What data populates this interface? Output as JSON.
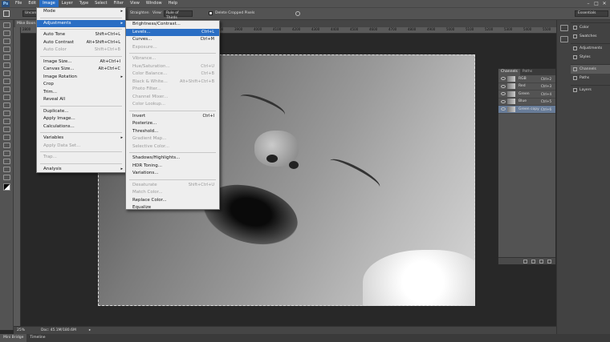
{
  "menubar": {
    "logo": "Ps",
    "items": [
      "File",
      "Edit",
      "Image",
      "Layer",
      "Type",
      "Select",
      "Filter",
      "View",
      "Window",
      "Help"
    ]
  },
  "options": {
    "brightness": "Straighten",
    "view_label": "View:",
    "view_value": "Rule of Thirds",
    "delete_label": "Delete Cropped Pixels",
    "unconstrained": "Unconst..."
  },
  "workspace": "Essentials",
  "document": {
    "tab": "Mike Boon..."
  },
  "rulers": [
    "2800",
    "2900",
    "3000",
    "3100",
    "3200",
    "3300",
    "3400",
    "3500",
    "3600",
    "3700",
    "3800",
    "3900",
    "4000",
    "4100",
    "4200",
    "4300",
    "4400",
    "4500",
    "4600",
    "4700",
    "4800",
    "4900",
    "5000",
    "5100",
    "5200",
    "5300",
    "5400",
    "5500"
  ],
  "status": {
    "zoom": "25%",
    "doc": "Doc: 45.1M/180.6M"
  },
  "bottom_tabs": [
    "Mini Bridge",
    "Timeline"
  ],
  "dock": {
    "groups": [
      [
        {
          "label": "Color",
          "icon": "color-icon"
        },
        {
          "label": "Swatches",
          "icon": "swatches-icon"
        }
      ],
      [
        {
          "label": "Adjustments",
          "icon": "adjustments-icon"
        },
        {
          "label": "Styles",
          "icon": "styles-icon"
        }
      ],
      [
        {
          "label": "Channels",
          "icon": "channels-icon",
          "active": true
        },
        {
          "label": "Paths",
          "icon": "paths-icon"
        }
      ],
      [
        {
          "label": "Layers",
          "icon": "layers-icon"
        }
      ]
    ]
  },
  "channels_panel": {
    "tabs": [
      "Channels",
      "Paths"
    ],
    "rows": [
      {
        "name": "RGB",
        "shortcut": "Ctrl+2"
      },
      {
        "name": "Red",
        "shortcut": "Ctrl+3"
      },
      {
        "name": "Green",
        "shortcut": "Ctrl+4"
      },
      {
        "name": "Blue",
        "shortcut": "Ctrl+5"
      },
      {
        "name": "Green copy",
        "shortcut": "Ctrl+6"
      }
    ]
  },
  "image_menu": [
    {
      "label": "Mode",
      "arrow": true
    },
    {
      "sep": true
    },
    {
      "label": "Adjustments",
      "arrow": true,
      "hl": true
    },
    {
      "sep": true
    },
    {
      "label": "Auto Tone",
      "sc": "Shift+Ctrl+L"
    },
    {
      "label": "Auto Contrast",
      "sc": "Alt+Shift+Ctrl+L"
    },
    {
      "label": "Auto Color",
      "sc": "Shift+Ctrl+B",
      "dis": true
    },
    {
      "sep": true
    },
    {
      "label": "Image Size...",
      "sc": "Alt+Ctrl+I"
    },
    {
      "label": "Canvas Size...",
      "sc": "Alt+Ctrl+C"
    },
    {
      "label": "Image Rotation",
      "arrow": true
    },
    {
      "label": "Crop"
    },
    {
      "label": "Trim..."
    },
    {
      "label": "Reveal All"
    },
    {
      "sep": true
    },
    {
      "label": "Duplicate..."
    },
    {
      "label": "Apply Image..."
    },
    {
      "label": "Calculations..."
    },
    {
      "sep": true
    },
    {
      "label": "Variables",
      "arrow": true
    },
    {
      "label": "Apply Data Set...",
      "dis": true
    },
    {
      "sep": true
    },
    {
      "label": "Trap...",
      "dis": true
    },
    {
      "sep": true
    },
    {
      "label": "Analysis",
      "arrow": true
    }
  ],
  "adjust_menu": [
    {
      "label": "Brightness/Contrast..."
    },
    {
      "label": "Levels...",
      "sc": "Ctrl+L",
      "hl": true
    },
    {
      "label": "Curves...",
      "sc": "Ctrl+M"
    },
    {
      "label": "Exposure...",
      "dis": true
    },
    {
      "sep": true
    },
    {
      "label": "Vibrance...",
      "dis": true
    },
    {
      "label": "Hue/Saturation...",
      "sc": "Ctrl+U",
      "dis": true
    },
    {
      "label": "Color Balance...",
      "sc": "Ctrl+B",
      "dis": true
    },
    {
      "label": "Black & White...",
      "sc": "Alt+Shift+Ctrl+B",
      "dis": true
    },
    {
      "label": "Photo Filter...",
      "dis": true
    },
    {
      "label": "Channel Mixer...",
      "dis": true
    },
    {
      "label": "Color Lookup...",
      "dis": true
    },
    {
      "sep": true
    },
    {
      "label": "Invert",
      "sc": "Ctrl+I"
    },
    {
      "label": "Posterize..."
    },
    {
      "label": "Threshold..."
    },
    {
      "label": "Gradient Map...",
      "dis": true
    },
    {
      "label": "Selective Color...",
      "dis": true
    },
    {
      "sep": true
    },
    {
      "label": "Shadows/Highlights..."
    },
    {
      "label": "HDR Toning..."
    },
    {
      "label": "Variations..."
    },
    {
      "sep": true
    },
    {
      "label": "Desaturate",
      "sc": "Shift+Ctrl+U",
      "dis": true
    },
    {
      "label": "Match Color...",
      "dis": true
    },
    {
      "label": "Replace Color..."
    },
    {
      "label": "Equalize"
    }
  ]
}
